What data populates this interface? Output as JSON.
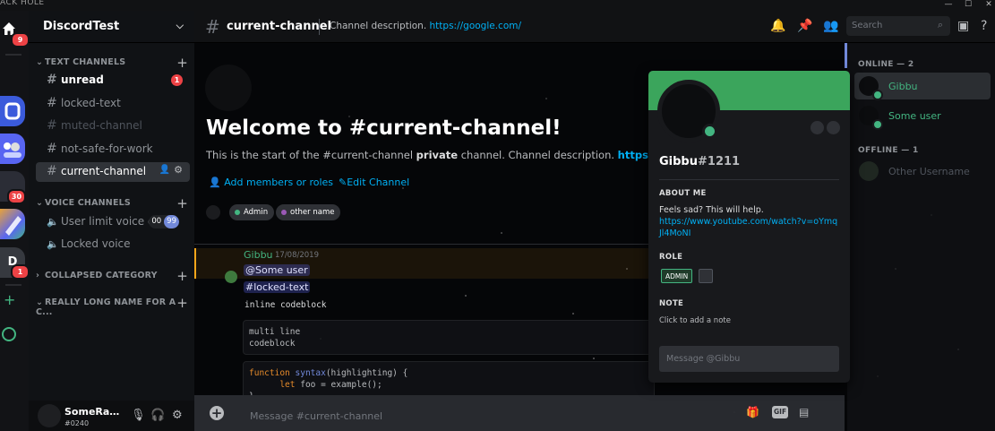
{
  "app": {
    "brand": "ACK HOLE"
  },
  "rail": {
    "home_badge": "9",
    "servers": [
      {
        "label": "",
        "badge": "",
        "color": "#3b5bdb"
      },
      {
        "label": "",
        "badge": "",
        "color": "#5865f2"
      },
      {
        "label": "",
        "badge": "30",
        "color": "#2b2d36"
      },
      {
        "label": "",
        "badge": "",
        "color": "#e8a23a"
      },
      {
        "label": "D",
        "badge": "1",
        "color": "#36393f"
      }
    ]
  },
  "sidebar": {
    "server_name": "DiscordTest",
    "categories": [
      {
        "label": "TEXT CHANNELS"
      },
      {
        "label": "VOICE CHANNELS"
      },
      {
        "label": "COLLAPSED CATEGORY"
      },
      {
        "label": "REALLY LONG NAME FOR A C..."
      }
    ],
    "channels": [
      {
        "name": "unread",
        "badge": "1"
      },
      {
        "name": "locked-text"
      },
      {
        "name": "muted-channel"
      },
      {
        "name": "not-safe-for-work"
      },
      {
        "name": "current-channel"
      }
    ],
    "voice": [
      {
        "name": "User limit voice ch...",
        "count": "00",
        "limit": "99"
      },
      {
        "name": "Locked voice"
      }
    ]
  },
  "user_panel": {
    "name": "SomeRando...",
    "discriminator": "#0240"
  },
  "header": {
    "channel": "current-channel",
    "description": "Channel description. ",
    "link": "https://google.com/",
    "search_placeholder": "Search"
  },
  "welcome": {
    "title": "Welcome to #current-channel!",
    "sub_prefix": "This is the start of the #current-channel ",
    "sub_bold": "private",
    "sub_middle": " channel. Channel description. ",
    "sub_link": "https://google.com/",
    "add_members": "Add members or roles",
    "edit_channel": "Edit Channel",
    "roles": [
      "Admin",
      "other name"
    ]
  },
  "message": {
    "author": "Gibbu",
    "timestamp": "17/08/2019",
    "mention_user": "@Some user",
    "mention_channel": "#locked-text",
    "inline_code": "inline codeblock",
    "code1_line1": "multi line",
    "code1_line2": "codeblock",
    "code2_kw1": "function",
    "code2_fn": "syntax",
    "code2_rest1": "(highlighting) {",
    "code2_kw2": "let",
    "code2_rest2": " foo = example();",
    "code2_line3": "}"
  },
  "input": {
    "placeholder": "Message #current-channel",
    "gif_label": "GIF"
  },
  "members": {
    "online_header": "ONLINE — 2",
    "offline_header": "OFFLINE — 1",
    "online": [
      "Gibbu",
      "Some user"
    ],
    "offline": [
      "Other Username"
    ]
  },
  "popout": {
    "username": "Gibbu",
    "discriminator": "#1211",
    "about_header": "ABOUT ME",
    "about_text": "Feels sad? This will help.",
    "about_link": "https://www.youtube.com/watch?v=oYmqJl4MoNI",
    "role_header": "ROLE",
    "role": "ADMIN",
    "note_header": "NOTE",
    "note_placeholder": "Click to add a note",
    "message_placeholder": "Message @Gibbu"
  },
  "colors": {
    "accent": "#7289da",
    "online": "#43b581",
    "link": "#00b0f4",
    "banner": "#3ba55c",
    "mention_hl": "#faa61a"
  }
}
